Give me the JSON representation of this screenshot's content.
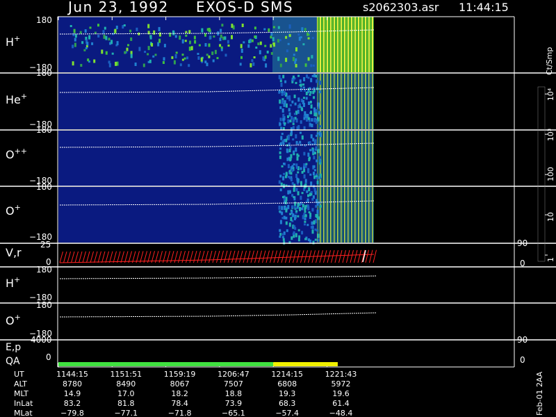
{
  "header": {
    "date": "Jun 23, 1992",
    "instrument": "EXOS-D SMS",
    "file": "s2062303.asr",
    "time": "11:44:15"
  },
  "panels": [
    {
      "label": "H",
      "sup": "+",
      "ymax": "180",
      "ymin": "−180"
    },
    {
      "label": "He",
      "sup": "+",
      "ymax": "180",
      "ymin": "−180"
    },
    {
      "label": "O",
      "sup": "++",
      "ymax": "180",
      "ymin": "−180"
    },
    {
      "label": "O",
      "sup": "+",
      "ymax": "180",
      "ymin": "−180"
    }
  ],
  "vr_panel": {
    "label": "V,r",
    "ymax": "25",
    "ymin": "0",
    "rmax": "90",
    "rmin": "0"
  },
  "lower_panels": [
    {
      "label": "H",
      "sup": "+",
      "ymax": "180",
      "ymin": "−180"
    },
    {
      "label": "O",
      "sup": "+",
      "ymax": "180",
      "ymin": "−180"
    }
  ],
  "ep_panel": {
    "label": "E,p",
    "ymax": "4000",
    "rmax": "90"
  },
  "qa_panel": {
    "label": "QA",
    "ymin": "0",
    "rmin": "0"
  },
  "colorbar": {
    "unit": "Ct/Smp",
    "labels": [
      "10⁴",
      "10³",
      "100",
      "10",
      "1"
    ],
    "label_values": [
      10000,
      1000,
      100,
      10,
      1
    ],
    "colors": [
      "#ffffff",
      "#7a0000",
      "#b00000",
      "#ff2000",
      "#6a5a00",
      "#8a8000",
      "#b8b000",
      "#e8e000",
      "#80e000",
      "#00c000",
      "#008000",
      "#00b0c0",
      "#005090",
      "#0a1a80",
      "#00006a"
    ]
  },
  "time_axis": {
    "rows": [
      {
        "label": "UT",
        "values": [
          "1144:15",
          "1151:51",
          "1159:19",
          "1206:47",
          "1214:15",
          "1221:43"
        ]
      },
      {
        "label": "ALT",
        "values": [
          "8780",
          "8490",
          "8067",
          "7507",
          "6808",
          "5972"
        ]
      },
      {
        "label": "MLT",
        "values": [
          "14.9",
          "17.0",
          "18.2",
          "18.8",
          "19.3",
          "19.6"
        ]
      },
      {
        "label": "InLat",
        "values": [
          "83.2",
          "81.8",
          "78.4",
          "73.9",
          "68.3",
          "61.4"
        ]
      },
      {
        "label": "MLat",
        "values": [
          "−79.8",
          "−77.1",
          "−71.8",
          "−65.1",
          "−57.4",
          "−48.4"
        ]
      }
    ]
  },
  "side_note": "Feb-01 2AA",
  "chart_data": {
    "type": "heatmap",
    "x_ticks": [
      "1144:15",
      "1151:51",
      "1159:19",
      "1206:47",
      "1214:15",
      "1221:43"
    ],
    "panels": [
      "H+",
      "He+",
      "O++",
      "O+",
      "V,r",
      "H+",
      "O+",
      "E,p",
      "QA"
    ],
    "y_range": [
      -180,
      180
    ],
    "color_scale": "log",
    "color_range": [
      1,
      10000
    ],
    "qa_segments": [
      {
        "color": "#40e040",
        "from_tick": 0,
        "to_tick": 4
      },
      {
        "color": "#f0f000",
        "from_tick": 4,
        "to_tick": 5.2
      }
    ]
  }
}
